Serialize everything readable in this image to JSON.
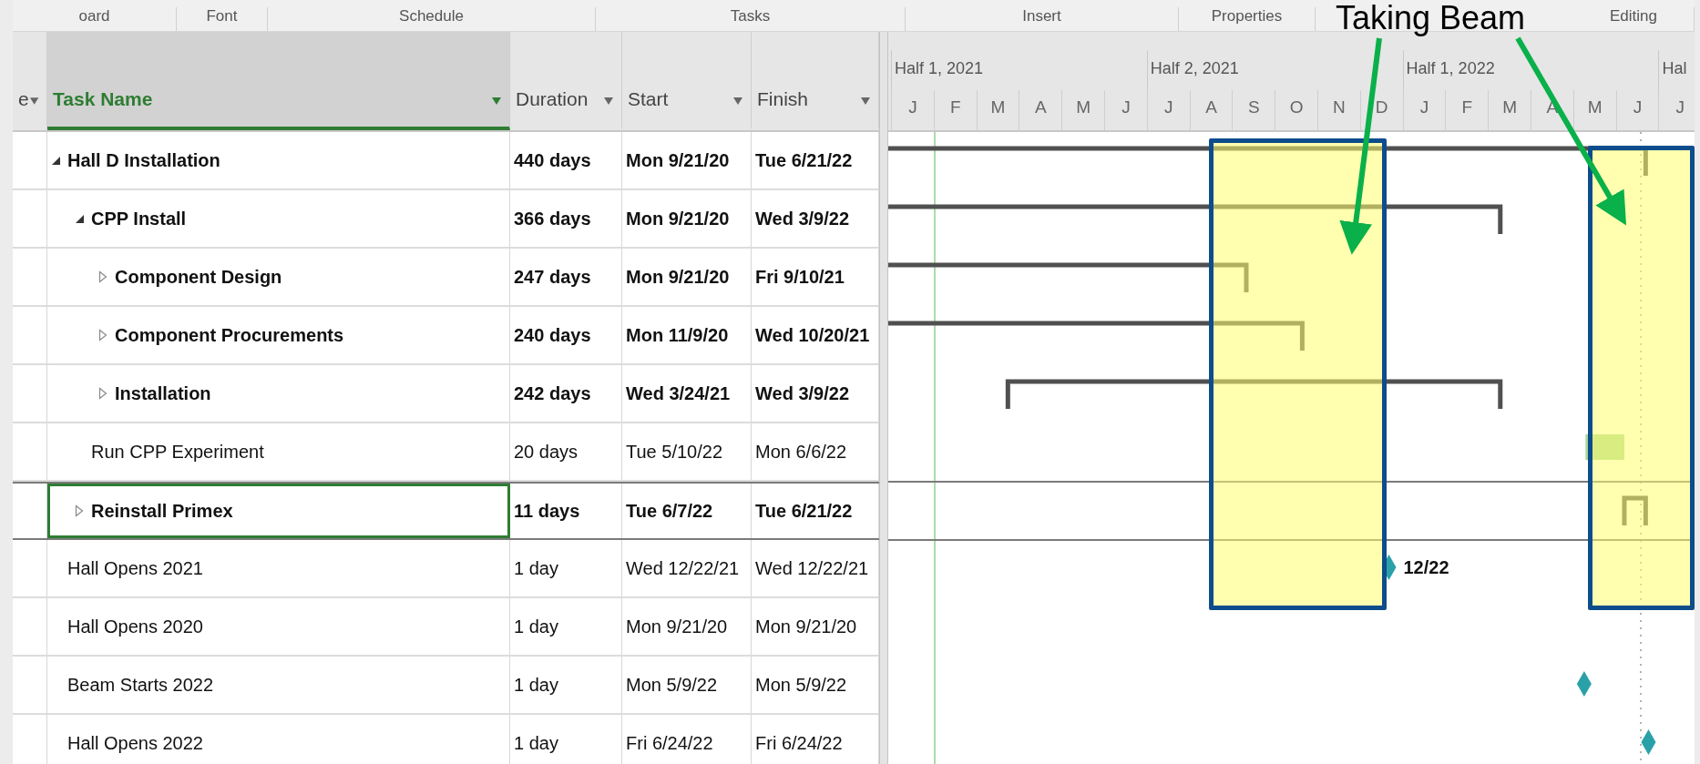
{
  "ribbon_groups": [
    "oard",
    "Font",
    "Schedule",
    "Tasks",
    "Insert",
    "Properties",
    "Editing"
  ],
  "annotation": {
    "text": "Taking Beam"
  },
  "columns": [
    {
      "label": "e",
      "selected": false
    },
    {
      "label": "Task Name",
      "selected": true
    },
    {
      "label": "Duration",
      "selected": false
    },
    {
      "label": "Start",
      "selected": false
    },
    {
      "label": "Finish",
      "selected": false
    }
  ],
  "timescale": {
    "halves": [
      "Half 1, 2021",
      "Half 2, 2021",
      "Half 1, 2022",
      "Hal"
    ],
    "months": [
      "J",
      "F",
      "M",
      "A",
      "M",
      "J",
      "J",
      "A",
      "S",
      "O",
      "N",
      "D",
      "J",
      "F",
      "M",
      "A",
      "M",
      "J",
      "J"
    ]
  },
  "tasks": [
    {
      "name": "Hall D Installation",
      "duration": "440 days",
      "start": "Mon 9/21/20",
      "finish": "Tue 6/21/22",
      "kind": "summary",
      "expanded": true,
      "selected": false,
      "children": [
        {
          "name": "CPP Install",
          "duration": "366 days",
          "start": "Mon 9/21/20",
          "finish": "Wed 3/9/22",
          "kind": "summary",
          "expanded": true,
          "selected": false,
          "children": [
            {
              "name": "Component Design",
              "duration": "247 days",
              "start": "Mon 9/21/20",
              "finish": "Fri 9/10/21",
              "kind": "summary",
              "expanded": false,
              "selected": false
            },
            {
              "name": "Component Procurements",
              "duration": "240 days",
              "start": "Mon 11/9/20",
              "finish": "Wed 10/20/21",
              "kind": "summary",
              "expanded": false,
              "selected": false
            },
            {
              "name": "Installation",
              "duration": "242 days",
              "start": "Wed 3/24/21",
              "finish": "Wed 3/9/22",
              "kind": "summary",
              "expanded": false,
              "selected": false
            }
          ]
        },
        {
          "name": "Run CPP Experiment",
          "duration": "20 days",
          "start": "Tue 5/10/22",
          "finish": "Mon 6/6/22",
          "kind": "task",
          "selected": false
        },
        {
          "name": "Reinstall Primex",
          "duration": "11 days",
          "start": "Tue 6/7/22",
          "finish": "Tue 6/21/22",
          "kind": "summary",
          "expanded": false,
          "selected": true
        }
      ]
    },
    {
      "name": "Hall Opens 2021",
      "duration": "1 day",
      "start": "Wed 12/22/21",
      "finish": "Wed 12/22/21",
      "kind": "milestone",
      "bar_label": "12/22",
      "selected": false
    },
    {
      "name": "Hall Opens 2020",
      "duration": "1 day",
      "start": "Mon 9/21/20",
      "finish": "Mon 9/21/20",
      "kind": "milestone",
      "selected": false
    },
    {
      "name": "Beam Starts 2022",
      "duration": "1 day",
      "start": "Mon 5/9/22",
      "finish": "Mon 5/9/22",
      "kind": "milestone",
      "selected": false
    },
    {
      "name": "Hall Opens 2022",
      "duration": "1 day",
      "start": "Fri 6/24/22",
      "finish": "Fri 6/24/22",
      "kind": "milestone",
      "selected": false
    }
  ]
}
